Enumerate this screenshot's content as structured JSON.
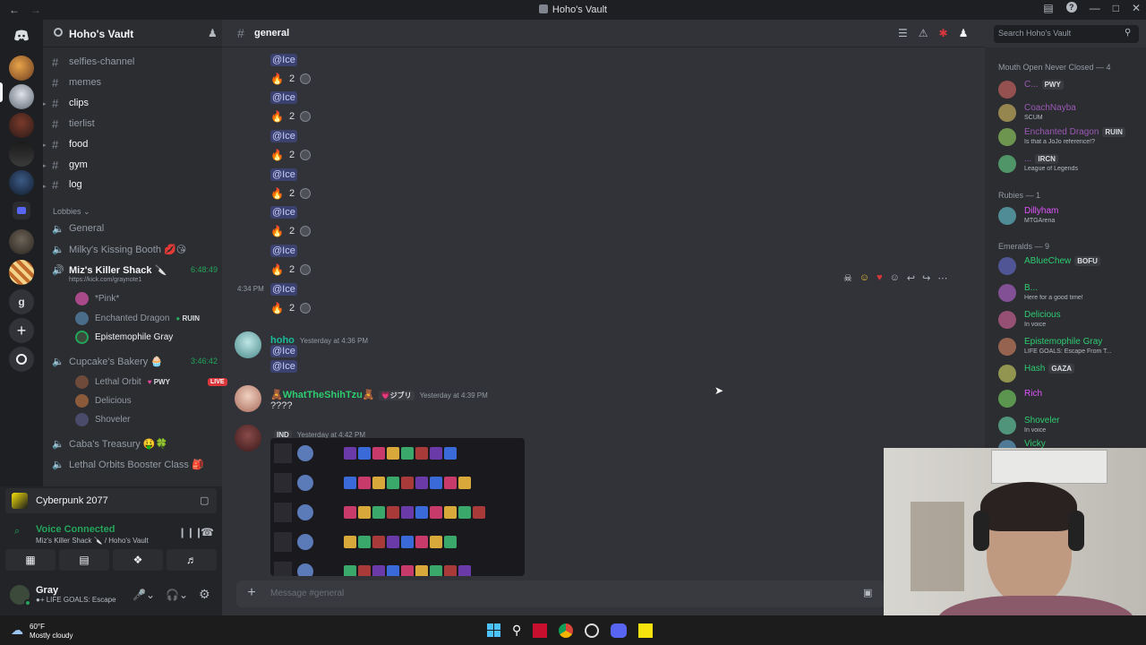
{
  "window": {
    "title": "Hoho's Vault"
  },
  "guild": {
    "name": "Hoho's Vault"
  },
  "channels": [
    {
      "name": "selfies-channel"
    },
    {
      "name": "memes"
    },
    {
      "name": "clips"
    },
    {
      "name": "tierlist"
    },
    {
      "name": "food"
    },
    {
      "name": "gym"
    },
    {
      "name": "log"
    }
  ],
  "lobbies_label": "Lobbies",
  "voice": [
    {
      "name": "General"
    },
    {
      "name": "Milky's Kissing Booth 💋😘"
    },
    {
      "name": "Miz's Killer Shack 🔪",
      "time": "6:48:49",
      "sub": "https://kick.com/graynote1"
    },
    {
      "name": "Cupcake's Bakery 🧁",
      "time": "3:46:42"
    },
    {
      "name": "Caba's Treasury 🤑🍀"
    },
    {
      "name": "Lethal Orbits Booster Class 🎒"
    }
  ],
  "voice_users_miz": [
    {
      "name": "*Pink*",
      "color": "#b5bac1"
    },
    {
      "name": "Enchanted Dragon",
      "tag": "RUIN",
      "color": "#b5bac1"
    },
    {
      "name": "Epistemophile Gray",
      "color": "#f2f3f5"
    }
  ],
  "voice_users_cupcake": [
    {
      "name": "Lethal Orbit",
      "tag": "PWY",
      "live": "LIVE"
    },
    {
      "name": "Delicious"
    },
    {
      "name": "Shoveler"
    }
  ],
  "activity": {
    "game": "Cyberpunk 2077"
  },
  "voice_status": {
    "label": "Voice Connected",
    "location": "Miz's Killer Shack 🔪 / Hoho's Vault"
  },
  "me": {
    "name": "Gray",
    "status": "LIFE GOALS: Escape"
  },
  "chat": {
    "channel": "general",
    "mention": "@Ice",
    "reaction_count": "2",
    "hover_time": "4:34 PM",
    "search_placeholder": "Search Hoho's Vault",
    "messages": [
      {
        "author": "hoho",
        "time": "Yesterday at 4:36 PM",
        "lines": [
          "@Ice",
          "@Ice"
        ],
        "color": "#1abc9c"
      },
      {
        "author": "🧸WhatTheShihTzu🧸",
        "badge": "💗ジブリ",
        "time": "Yesterday at 4:39 PM",
        "text": "????",
        "color": "#2ecc71"
      },
      {
        "author": "",
        "badge": "IND",
        "time": "Yesterday at 4:42 PM",
        "color": "#dbdee1"
      }
    ],
    "input_placeholder": "Message #general"
  },
  "members": {
    "groups": [
      {
        "label": "Mouth Open Never Closed — 4"
      },
      {
        "label": "Rubies — 1"
      },
      {
        "label": "Emeralds — 9"
      }
    ],
    "list": [
      {
        "name": "C...",
        "tag": "PWY",
        "status": "",
        "color": "#9b59b6"
      },
      {
        "name": "CoachNayba",
        "status": "SCUM",
        "color": "#9b59b6"
      },
      {
        "name": "Enchanted Dragon",
        "tag": "RUIN",
        "status": "Is that a JoJo reference!?",
        "color": "#9b59b6"
      },
      {
        "name": "...",
        "tag": "IRCN",
        "status": "League of Legends",
        "color": "#9b59b6"
      },
      {
        "name": "Dillyham",
        "status": "MTGArena",
        "color": "#e056fd"
      },
      {
        "name": "ABlueChew",
        "tag": "BOFU",
        "status": "",
        "color": "#2ecc71"
      },
      {
        "name": "B...",
        "status": "Here for a good time!",
        "color": "#2ecc71"
      },
      {
        "name": "Delicious",
        "status": "In voice",
        "color": "#2ecc71"
      },
      {
        "name": "Epistemophile Gray",
        "status": "LIFE GOALS: Escape From T...",
        "color": "#2ecc71"
      },
      {
        "name": "Hash",
        "tag": "GAZA",
        "status": "",
        "color": "#2ecc71"
      },
      {
        "name": "Rich",
        "status": "",
        "color": "#e056fd"
      },
      {
        "name": "Shoveler",
        "status": "In voice",
        "color": "#2ecc71"
      },
      {
        "name": "Vicky",
        "status": "",
        "color": "#2ecc71"
      }
    ]
  },
  "weather": {
    "temp": "60°F",
    "desc": "Mostly cloudy"
  }
}
